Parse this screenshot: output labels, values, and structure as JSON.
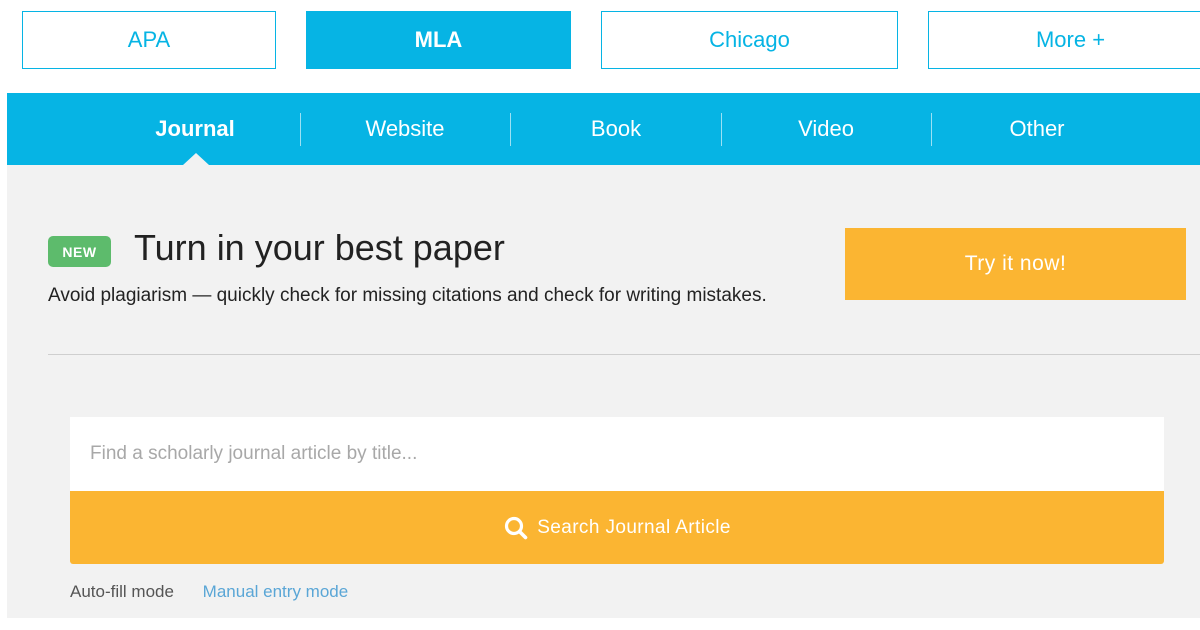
{
  "citation_styles": {
    "tabs": [
      {
        "label": "APA",
        "active": false
      },
      {
        "label": "MLA",
        "active": true
      },
      {
        "label": "Chicago",
        "active": false
      },
      {
        "label": "More +",
        "active": false
      }
    ]
  },
  "source_types": {
    "items": [
      {
        "label": "Journal",
        "active": true
      },
      {
        "label": "Website",
        "active": false
      },
      {
        "label": "Book",
        "active": false
      },
      {
        "label": "Video",
        "active": false
      },
      {
        "label": "Other",
        "active": false
      }
    ]
  },
  "promo": {
    "badge": "NEW",
    "title": "Turn in your best paper",
    "subtitle": "Avoid plagiarism — quickly check for missing citations and check for writing mistakes.",
    "cta_label": "Try it now!"
  },
  "search": {
    "placeholder": "Find a scholarly journal article by title...",
    "value": "",
    "button_label": "Search Journal Article",
    "button_icon": "search-icon"
  },
  "modes": {
    "autofill_label": "Auto-fill mode",
    "manual_label": "Manual entry mode"
  },
  "colors": {
    "brand_blue": "#06b4e4",
    "accent_orange": "#fbb532",
    "new_badge_green": "#5dbb6c",
    "link_blue": "#5aa6d6",
    "panel_grey": "#f2f2f2"
  }
}
